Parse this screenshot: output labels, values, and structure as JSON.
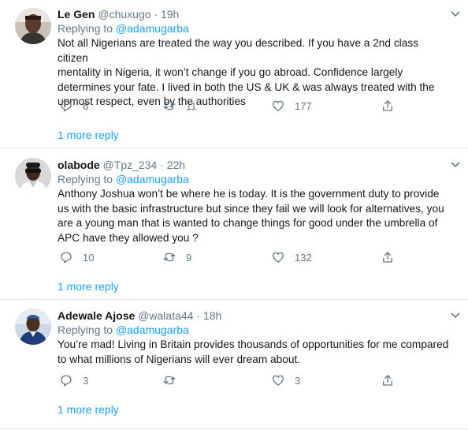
{
  "tweets": [
    {
      "name": "Le Gen",
      "handle": "@chuxugo",
      "sep": "·",
      "time": "19h",
      "replying_prefix": "Replying to ",
      "replying_to": "@adamugarba",
      "lines": [
        "Not all Nigerians are treated the way you described. If you have a 2nd class citizen",
        "mentality in Nigeria, it won’t change if you go abroad. Confidence largely",
        "determines your fate. I lived in both the US & UK & was always treated with the",
        "upmost respect, even by the authorities"
      ],
      "replies": "6",
      "retweets": "11",
      "likes": "177",
      "more_replies": "1 more reply"
    },
    {
      "name": "olabode",
      "handle": "@Tpz_234",
      "sep": "·",
      "time": "22h",
      "replying_prefix": "Replying to ",
      "replying_to": "@adamugarba",
      "lines": [
        "Anthony Joshua won’t be where he is today. It is the government duty to provide",
        "us with the basic infrastructure but since they fail we will look for alternatives, you",
        "are a young man that is wanted to change things for good under the umbrella of",
        "APC have they allowed you ?"
      ],
      "replies": "10",
      "retweets": "9",
      "likes": "132",
      "more_replies": "1 more reply"
    },
    {
      "name": "Adewale Ajose",
      "handle": "@walata44",
      "sep": "·",
      "time": "18h",
      "replying_prefix": "Replying to ",
      "replying_to": "@adamugarba",
      "lines": [
        "You’re mad! Living in Britain provides thousands of opportunities for me compared",
        "to what millions of Nigerians will ever dream about."
      ],
      "replies": "3",
      "retweets": "",
      "likes": "3",
      "more_replies": "1 more reply"
    }
  ],
  "icons": [
    "reply-icon",
    "retweet-icon",
    "like-icon",
    "share-icon",
    "chevron-down-icon"
  ],
  "colors": {
    "link": "#1da1f2",
    "muted": "#657786",
    "divider": "#e1e8ed",
    "text": "#14171a"
  }
}
